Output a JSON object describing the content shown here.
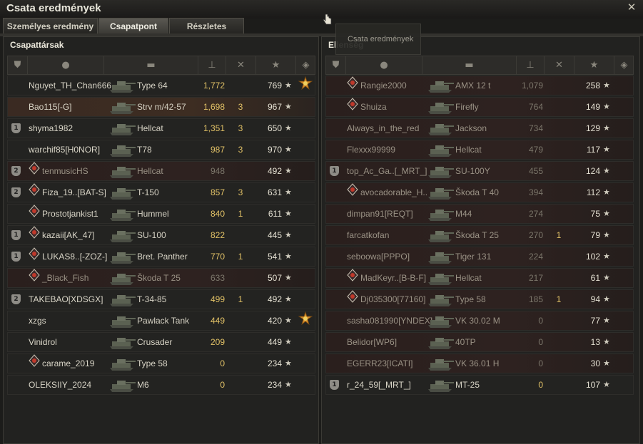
{
  "window": {
    "title": "Csata eredmények"
  },
  "tabs": [
    {
      "label": "Személyes eredmény",
      "active": false
    },
    {
      "label": "Csapatpont",
      "active": true
    },
    {
      "label": "Részletes jelentés",
      "active": false
    }
  ],
  "tooltip": {
    "text": "Csata eredmények"
  },
  "left_team": {
    "title": "Csapattársak",
    "rows": [
      {
        "name": "Nguyet_TH_Chan666",
        "tank": "Type 64",
        "damage": "1,772",
        "kills": "",
        "xp": "769",
        "medal": true,
        "badge": "",
        "clan": false,
        "state": "alive"
      },
      {
        "name": "Bao115[-G]",
        "tank": "Strv m/42-57",
        "damage": "1,698",
        "kills": "3",
        "xp": "967",
        "medal": false,
        "badge": "",
        "clan": false,
        "state": "self"
      },
      {
        "name": "shyma1982",
        "tank": "Hellcat",
        "damage": "1,351",
        "kills": "3",
        "xp": "650",
        "medal": false,
        "badge": "1",
        "clan": false,
        "state": "alive"
      },
      {
        "name": "warchif85[H0NOR]",
        "tank": "T78",
        "damage": "987",
        "kills": "3",
        "xp": "970",
        "medal": false,
        "badge": "",
        "clan": false,
        "state": "alive"
      },
      {
        "name": "tenmusicHS",
        "tank": "Hellcat",
        "damage": "948",
        "kills": "",
        "xp": "492",
        "medal": false,
        "badge": "2",
        "clan": true,
        "state": "dead"
      },
      {
        "name": "Fiza_19..[BAT-S]",
        "tank": "T-150",
        "damage": "857",
        "kills": "3",
        "xp": "631",
        "medal": false,
        "badge": "2",
        "clan": true,
        "state": "alive"
      },
      {
        "name": "Prostotjankist1",
        "tank": "Hummel",
        "damage": "840",
        "kills": "1",
        "xp": "611",
        "medal": false,
        "badge": "",
        "clan": true,
        "state": "alive"
      },
      {
        "name": "kazaii[AK_47]",
        "tank": "SU-100",
        "damage": "822",
        "kills": "",
        "xp": "445",
        "medal": false,
        "badge": "1",
        "clan": true,
        "state": "alive"
      },
      {
        "name": "LUKAS8..[-ZOZ-]",
        "tank": "Bret. Panther",
        "damage": "770",
        "kills": "1",
        "xp": "541",
        "medal": false,
        "badge": "1",
        "clan": true,
        "state": "alive"
      },
      {
        "name": "_Black_Fish",
        "tank": "Škoda T 25",
        "damage": "633",
        "kills": "",
        "xp": "507",
        "medal": false,
        "badge": "",
        "clan": true,
        "state": "dead"
      },
      {
        "name": "TAKEBAO[XDSGX]",
        "tank": "T-34-85",
        "damage": "499",
        "kills": "1",
        "xp": "492",
        "medal": false,
        "badge": "2",
        "clan": false,
        "state": "alive"
      },
      {
        "name": "xzgs",
        "tank": "Pawlack Tank",
        "damage": "449",
        "kills": "",
        "xp": "420",
        "medal": true,
        "badge": "",
        "clan": false,
        "state": "alive"
      },
      {
        "name": "Vinidrol",
        "tank": "Crusader",
        "damage": "209",
        "kills": "",
        "xp": "449",
        "medal": false,
        "badge": "",
        "clan": false,
        "state": "alive"
      },
      {
        "name": "carame_2019",
        "tank": "Type 58",
        "damage": "0",
        "kills": "",
        "xp": "234",
        "medal": false,
        "badge": "",
        "clan": true,
        "state": "alive"
      },
      {
        "name": "OLEKSIIY_2024",
        "tank": "M6",
        "damage": "0",
        "kills": "",
        "xp": "234",
        "medal": false,
        "badge": "",
        "clan": false,
        "state": "alive"
      }
    ]
  },
  "right_team": {
    "title": "Ellenség",
    "rows": [
      {
        "name": "Rangie2000",
        "tank": "AMX 12 t",
        "damage": "1,079",
        "kills": "",
        "xp": "258",
        "badge": "",
        "clan": true,
        "state": "dead"
      },
      {
        "name": "Shuiza",
        "tank": "Firefly",
        "damage": "764",
        "kills": "",
        "xp": "149",
        "badge": "",
        "clan": true,
        "state": "dead"
      },
      {
        "name": "Always_in_the_red",
        "tank": "Jackson",
        "damage": "734",
        "kills": "",
        "xp": "129",
        "badge": "",
        "clan": false,
        "state": "dead"
      },
      {
        "name": "Flexxx99999",
        "tank": "Hellcat",
        "damage": "479",
        "kills": "",
        "xp": "117",
        "badge": "",
        "clan": false,
        "state": "dead"
      },
      {
        "name": "top_Ac_Ga..[_MRT_]",
        "tank": "SU-100Y",
        "damage": "455",
        "kills": "",
        "xp": "124",
        "badge": "1",
        "clan": false,
        "state": "dead"
      },
      {
        "name": "avocadorable_H..",
        "tank": "Škoda T 40",
        "damage": "394",
        "kills": "",
        "xp": "112",
        "badge": "",
        "clan": true,
        "state": "dead"
      },
      {
        "name": "dimpan91[REQT]",
        "tank": "M44",
        "damage": "274",
        "kills": "",
        "xp": "75",
        "badge": "",
        "clan": false,
        "state": "dead"
      },
      {
        "name": "farcatkofan",
        "tank": "Škoda T 25",
        "damage": "270",
        "kills": "1",
        "xp": "79",
        "badge": "",
        "clan": false,
        "state": "dead"
      },
      {
        "name": "seboowa[PPPO]",
        "tank": "Tiger 131",
        "damage": "224",
        "kills": "",
        "xp": "102",
        "badge": "",
        "clan": false,
        "state": "dead"
      },
      {
        "name": "MadKeyr..[B-B-F]",
        "tank": "Hellcat",
        "damage": "217",
        "kills": "",
        "xp": "61",
        "badge": "",
        "clan": true,
        "state": "dead"
      },
      {
        "name": "Dj035300[77160]",
        "tank": "Type 58",
        "damage": "185",
        "kills": "1",
        "xp": "94",
        "badge": "",
        "clan": true,
        "state": "dead"
      },
      {
        "name": "sasha081990[YNDEX]",
        "tank": "VK 30.02 M",
        "damage": "0",
        "kills": "",
        "xp": "77",
        "badge": "",
        "clan": false,
        "state": "dead"
      },
      {
        "name": "Belidor[WP6]",
        "tank": "40TP",
        "damage": "0",
        "kills": "",
        "xp": "13",
        "badge": "",
        "clan": false,
        "state": "dead"
      },
      {
        "name": "EGERR23[ICATI]",
        "tank": "VK 36.01 H",
        "damage": "0",
        "kills": "",
        "xp": "30",
        "badge": "",
        "clan": false,
        "state": "dead"
      },
      {
        "name": "r_24_59[_MRT_]",
        "tank": "MT-25",
        "damage": "0",
        "kills": "",
        "xp": "107",
        "badge": "1",
        "clan": false,
        "state": "alive"
      }
    ]
  },
  "icons": {
    "close": "close-icon",
    "col_badge": "badge-column-icon",
    "col_player": "player-column-icon",
    "col_tank": "tank-column-icon",
    "col_damage": "damage-column-icon",
    "col_kills": "kills-column-icon",
    "col_xp": "xp-star-icon",
    "col_medal": "medal-column-icon"
  }
}
